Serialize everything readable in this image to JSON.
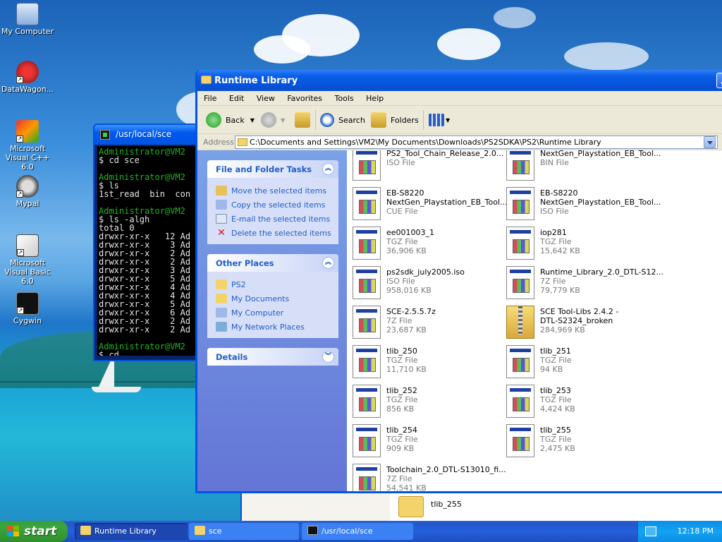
{
  "desktop": {
    "icons": [
      {
        "label": "My Computer"
      },
      {
        "label": "DataWagon..."
      },
      {
        "label": "Microsoft Visual C++ 6.0"
      },
      {
        "label": "Mypal"
      },
      {
        "label": "Microsoft Visual Basic 6.0"
      },
      {
        "label": "Cygwin"
      }
    ]
  },
  "terminal": {
    "title": "/usr/local/sce",
    "lines": [
      {
        "text": "Administrator@VM2",
        "green": true
      },
      {
        "text": "$ cd sce",
        "green": false
      },
      {
        "text": "",
        "green": false
      },
      {
        "text": "Administrator@VM2",
        "green": true
      },
      {
        "text": "$ ls",
        "green": false
      },
      {
        "text": "1st_read  bin  con",
        "green": false
      },
      {
        "text": "",
        "green": false
      },
      {
        "text": "Administrator@VM2",
        "green": true
      },
      {
        "text": "$ ls -algh",
        "green": false
      },
      {
        "text": "total 0",
        "green": false
      },
      {
        "text": "drwxr-xr-x   12 Ad",
        "green": false
      },
      {
        "text": "drwxr-xr-x    3 Ad",
        "green": false
      },
      {
        "text": "drwxr-xr-x    2 Ad",
        "green": false
      },
      {
        "text": "drwxr-xr-x    2 Ad",
        "green": false
      },
      {
        "text": "drwxr-xr-x    3 Ad",
        "green": false
      },
      {
        "text": "drwxr-xr-x    5 Ad",
        "green": false
      },
      {
        "text": "drwxr-xr-x    4 Ad",
        "green": false
      },
      {
        "text": "drwxr-xr-x    4 Ad",
        "green": false
      },
      {
        "text": "drwxr-xr-x    5 Ad",
        "green": false
      },
      {
        "text": "drwxr-xr-x    6 Ad",
        "green": false
      },
      {
        "text": "drwxr-xr-x    2 Ad",
        "green": false
      },
      {
        "text": "drwxr-xr-x    2 Ad",
        "green": false
      },
      {
        "text": "",
        "green": false
      },
      {
        "text": "Administrator@VM2",
        "green": true
      },
      {
        "text": "$ cd",
        "green": false
      }
    ]
  },
  "explorer": {
    "title": "Runtime Library",
    "menu": [
      "File",
      "Edit",
      "View",
      "Favorites",
      "Tools",
      "Help"
    ],
    "toolbar": {
      "back": "Back",
      "search": "Search",
      "folders": "Folders"
    },
    "address": {
      "label": "Address",
      "path": "C:\\Documents and Settings\\VM2\\My Documents\\Downloads\\PS2SDKA\\PS2\\Runtime Library"
    },
    "tasks": {
      "title": "File and Folder Tasks",
      "items": [
        "Move the selected items",
        "Copy the selected items",
        "E-mail the selected items",
        "Delete the selected items"
      ]
    },
    "other_places": {
      "title": "Other Places",
      "items": [
        "PS2",
        "My Documents",
        "My Computer",
        "My Network Places"
      ]
    },
    "details": {
      "title": "Details"
    },
    "files": [
      {
        "name": "PS2_Tool_Chain_Release_2.0...",
        "type": "ISO File",
        "size": "",
        "icon": "doc"
      },
      {
        "name": "NextGen_Playstation_EB_Tool...",
        "type": "BIN File",
        "size": "",
        "icon": "doc"
      },
      {
        "name": "EB-S8220 NextGen_Playstation_EB_Tool...",
        "name2": "NextGen_Playstation_EB_Tool...",
        "name1": "EB-S8220",
        "type": "CUE File",
        "size": "",
        "icon": "doc"
      },
      {
        "name": "EB-S8220 NextGen_Playstation_EB_Tool...",
        "name2": "NextGen_Playstation_EB_Tool...",
        "name1": "EB-S8220",
        "type": "ISO File",
        "size": "",
        "icon": "doc"
      },
      {
        "name": "ee001003_1",
        "type": "TGZ File",
        "size": "36,906 KB",
        "icon": "doc"
      },
      {
        "name": "iop281",
        "type": "TGZ File",
        "size": "15,642 KB",
        "icon": "doc"
      },
      {
        "name": "ps2sdk_july2005.iso",
        "type": "ISO File",
        "size": "958,016 KB",
        "icon": "doc"
      },
      {
        "name": "Runtime_Library_2.0_DTL-S12...",
        "type": "7Z File",
        "size": "79,779 KB",
        "icon": "doc"
      },
      {
        "name": "SCE-2.5.5.7z",
        "type": "7Z File",
        "size": "23,687 KB",
        "icon": "doc"
      },
      {
        "name": "SCE Tool-Libs 2.4.2 - DTL-S2324_broken",
        "name1": "SCE Tool-Libs 2.4.2 -",
        "name2": "DTL-S2324_broken",
        "type": "",
        "size": "284,969 KB",
        "icon": "zip"
      },
      {
        "name": "tlib_250",
        "type": "TGZ File",
        "size": "11,710 KB",
        "icon": "doc"
      },
      {
        "name": "tlib_251",
        "type": "TGZ File",
        "size": "94 KB",
        "icon": "doc"
      },
      {
        "name": "tlib_252",
        "type": "TGZ File",
        "size": "856 KB",
        "icon": "doc"
      },
      {
        "name": "tlib_253",
        "type": "TGZ File",
        "size": "4,424 KB",
        "icon": "doc"
      },
      {
        "name": "tlib_254",
        "type": "TGZ File",
        "size": "909 KB",
        "icon": "doc"
      },
      {
        "name": "tlib_255",
        "type": "TGZ File",
        "size": "2,475 KB",
        "icon": "doc"
      },
      {
        "name": "Toolchain_2.0_DTL-S13010_fi...",
        "type": "7Z File",
        "size": "54,541 KB",
        "icon": "doc"
      }
    ]
  },
  "behind_window": {
    "item": "tlib_255"
  },
  "taskbar": {
    "start": "start",
    "tasks": [
      "Runtime Library",
      "sce",
      "/usr/local/sce"
    ],
    "clock": "12:18 PM"
  },
  "colors": {
    "xp_blue": "#0054e3",
    "link_blue": "#215dc6",
    "start_green": "#3aa53a"
  }
}
